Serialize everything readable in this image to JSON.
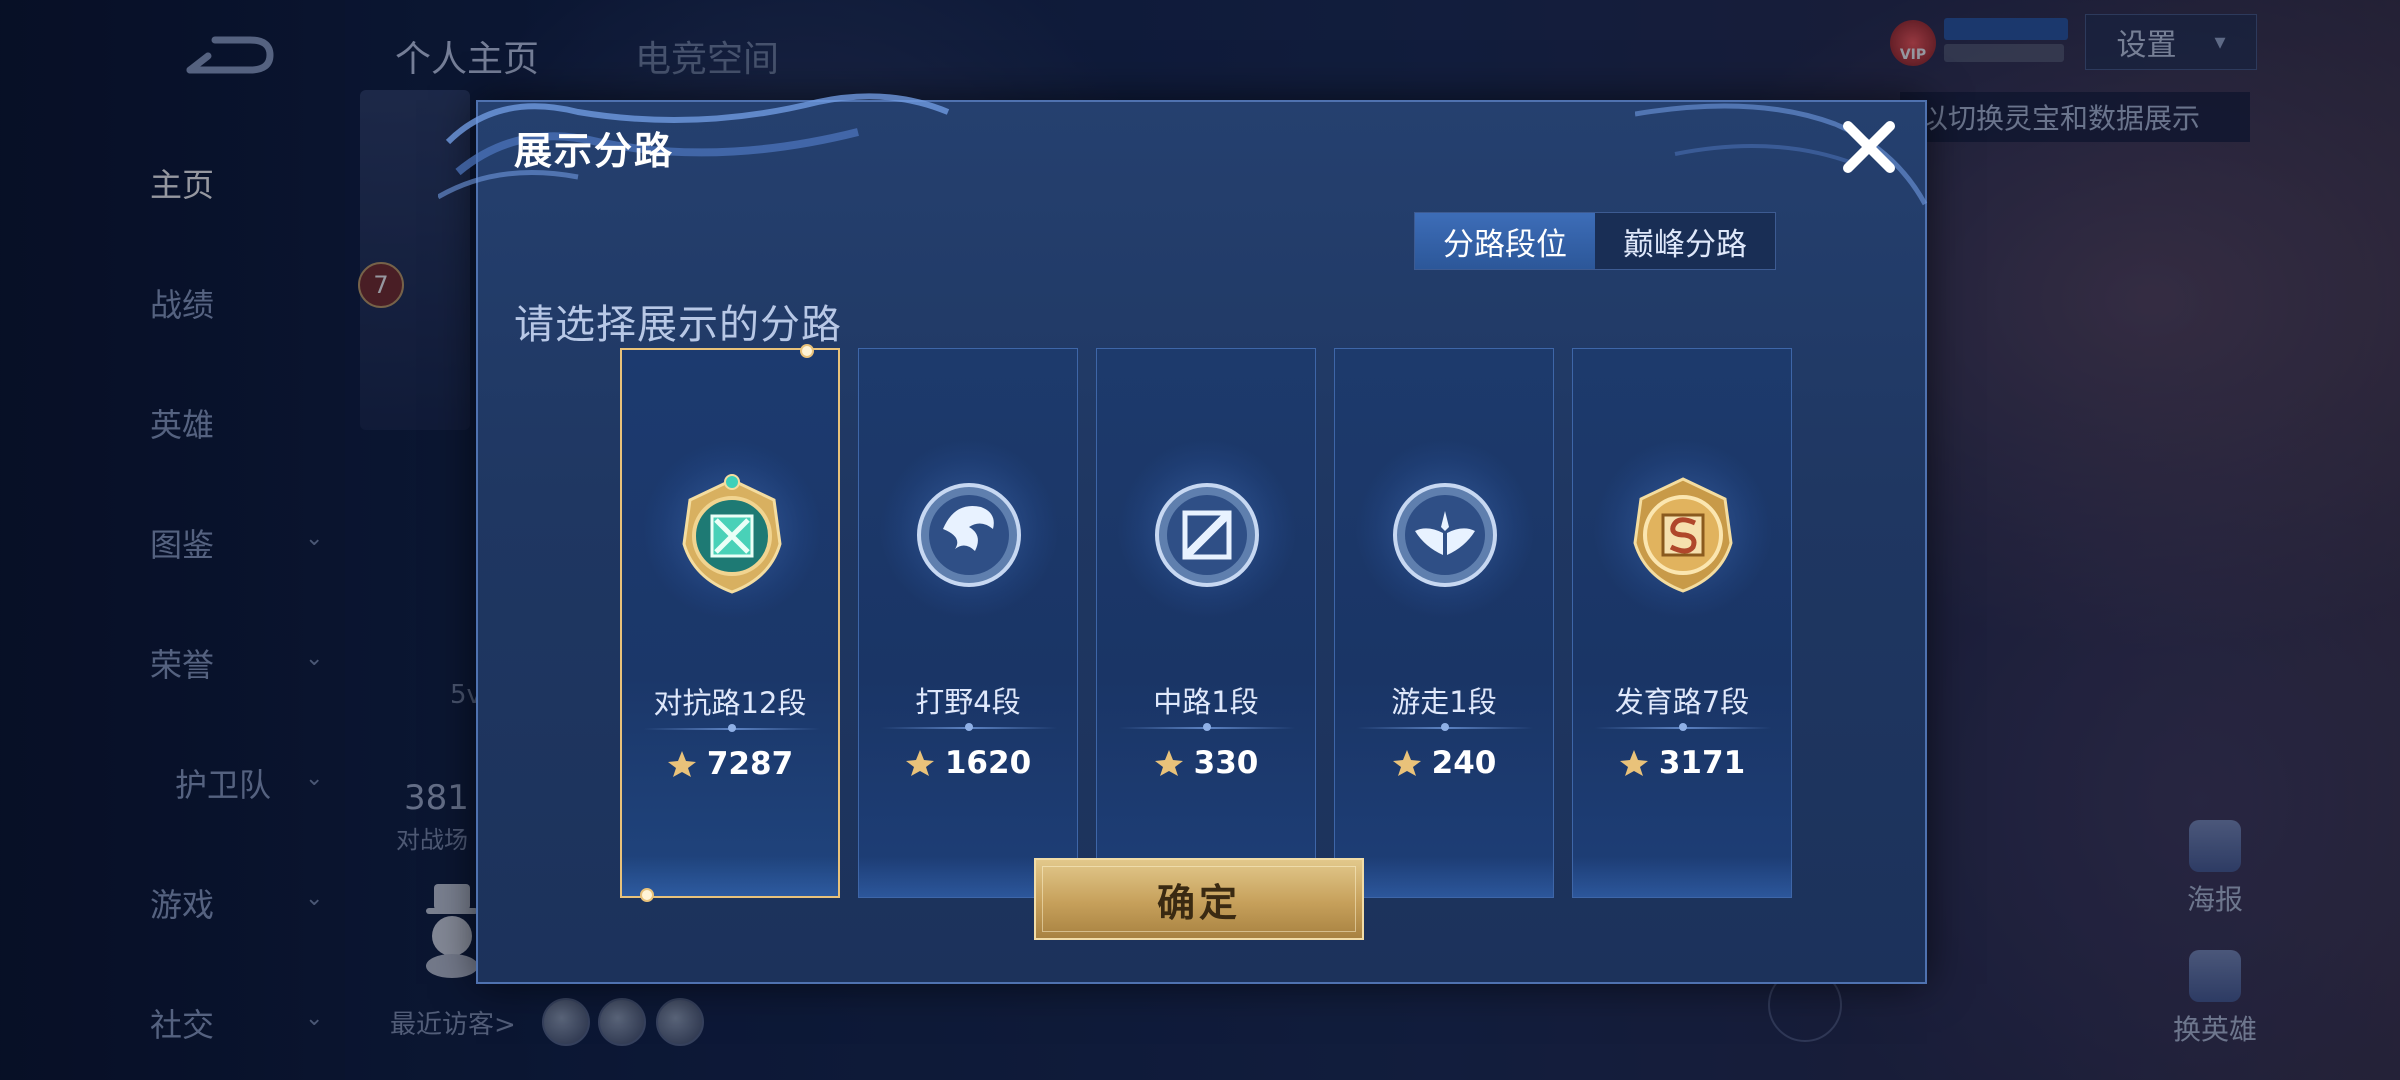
{
  "background": {
    "top_tabs": [
      {
        "label": "个人主页"
      },
      {
        "label": "电竞空间"
      }
    ],
    "nav": [
      {
        "label": "主页",
        "expandable": false
      },
      {
        "label": "战绩",
        "expandable": false
      },
      {
        "label": "英雄",
        "expandable": false
      },
      {
        "label": "图鉴",
        "expandable": true
      },
      {
        "label": "荣誉",
        "expandable": true
      },
      {
        "label": "护卫队",
        "expandable": true
      },
      {
        "label": "游戏",
        "expandable": true
      },
      {
        "label": "社交",
        "expandable": true
      }
    ],
    "level": "7",
    "stats_number": "381",
    "stats_label": "对战场",
    "fivew": "5v",
    "recent_visitors_label": "最近访客>",
    "settings_label": "设置",
    "vip_text": "VIP",
    "hint_text": "以切换灵宝和数据展示",
    "side_actions": [
      {
        "label": "海报"
      },
      {
        "label": "换英雄"
      }
    ]
  },
  "modal": {
    "title": "展示分路",
    "tabs": [
      {
        "label": "分路段位",
        "active": true
      },
      {
        "label": "巅峰分路",
        "active": false
      }
    ],
    "prompt": "请选择展示的分路",
    "lanes": [
      {
        "name": "对抗路12段",
        "score": "7287",
        "emblem": "clash-lane-emblem",
        "selected": true
      },
      {
        "name": "打野4段",
        "score": "1620",
        "emblem": "jungle-emblem",
        "selected": false
      },
      {
        "name": "中路1段",
        "score": "330",
        "emblem": "mid-lane-emblem",
        "selected": false
      },
      {
        "name": "游走1段",
        "score": "240",
        "emblem": "roam-emblem",
        "selected": false
      },
      {
        "name": "发育路7段",
        "score": "3171",
        "emblem": "farm-lane-emblem",
        "selected": false
      }
    ],
    "confirm_label": "确定"
  },
  "colors": {
    "accent_gold": "#e9c27a",
    "tab_active": "#2c5799",
    "modal_bg": "#1f3762"
  }
}
